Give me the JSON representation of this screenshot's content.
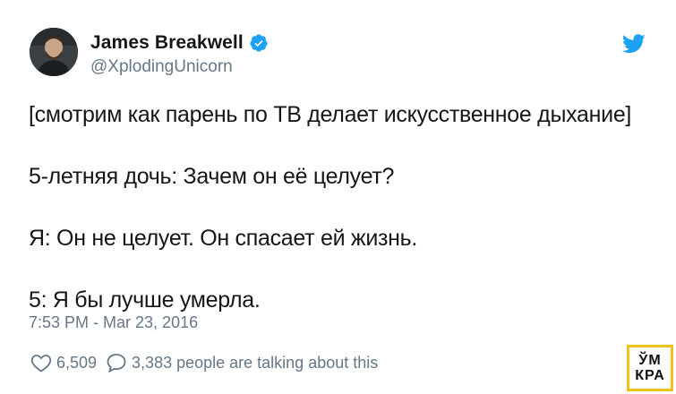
{
  "author": {
    "display_name": "James Breakwell",
    "handle": "@XplodingUnicorn",
    "verified": true
  },
  "tweet": {
    "lines": [
      "[смотрим как парень по ТВ делает искусственное дыхание]",
      "5-летняя дочь: Зачем он её целует?",
      "Я:  Он не целует. Он спасает ей жизнь.",
      "5: Я бы лучше умерла."
    ],
    "timestamp": "7:53 PM - Mar 23, 2016"
  },
  "actions": {
    "likes": "6,509",
    "replies_text": "3,383 people are talking about this"
  },
  "watermark": {
    "line1": "ЎМ",
    "line2": "КРА"
  },
  "colors": {
    "twitter_blue": "#1da1f2",
    "secondary_text": "#657786",
    "primary_text": "#14171a",
    "watermark_border": "#f0c21b"
  },
  "icons": [
    "verified-badge-icon",
    "twitter-bird-icon",
    "heart-icon",
    "reply-bubble-icon"
  ]
}
